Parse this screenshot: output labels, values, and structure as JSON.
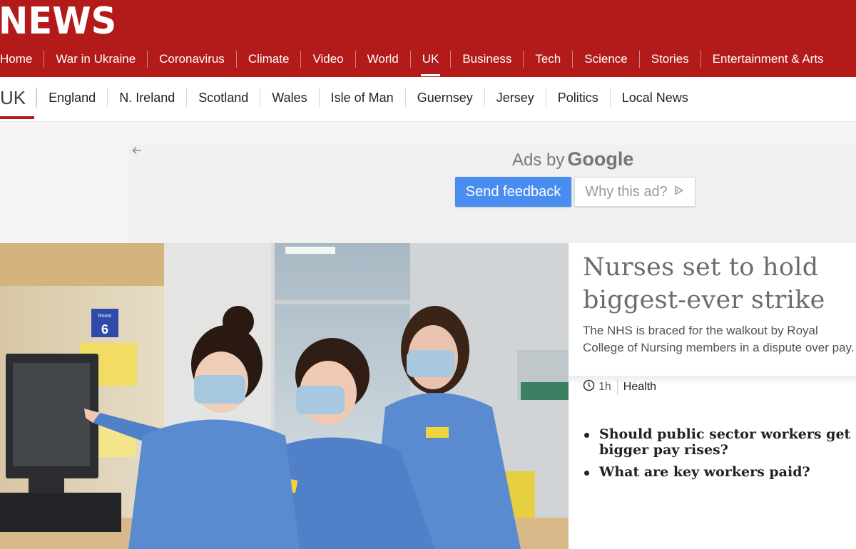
{
  "header": {
    "logo": "NEWS",
    "nav": [
      "Home",
      "War in Ukraine",
      "Coronavirus",
      "Climate",
      "Video",
      "World",
      "UK",
      "Business",
      "Tech",
      "Science",
      "Stories",
      "Entertainment & Arts"
    ],
    "active_nav": "UK",
    "brand_color": "#b31b1b"
  },
  "subnav": {
    "title": "UK",
    "items": [
      "England",
      "N. Ireland",
      "Scotland",
      "Wales",
      "Isle of Man",
      "Guernsey",
      "Jersey",
      "Politics",
      "Local News"
    ]
  },
  "ad": {
    "ads_by": "Ads by",
    "google": "Google",
    "send_feedback": "Send feedback",
    "why_this_ad": "Why this ad?",
    "back_icon": "arrow-left-icon",
    "adchoices_icon": "adchoices-icon"
  },
  "article": {
    "headline": "Nurses set to hold biggest-ever strike",
    "summary": "The NHS is braced for the walkout by Royal College of Nursing members in a dispute over pay.",
    "time": "1h",
    "time_icon": "clock-icon",
    "tag": "Health",
    "related": [
      "Should public sector workers get bigger pay rises?",
      "What are key workers paid?"
    ]
  },
  "image": {
    "room_label": "Room",
    "room_number": "6"
  }
}
